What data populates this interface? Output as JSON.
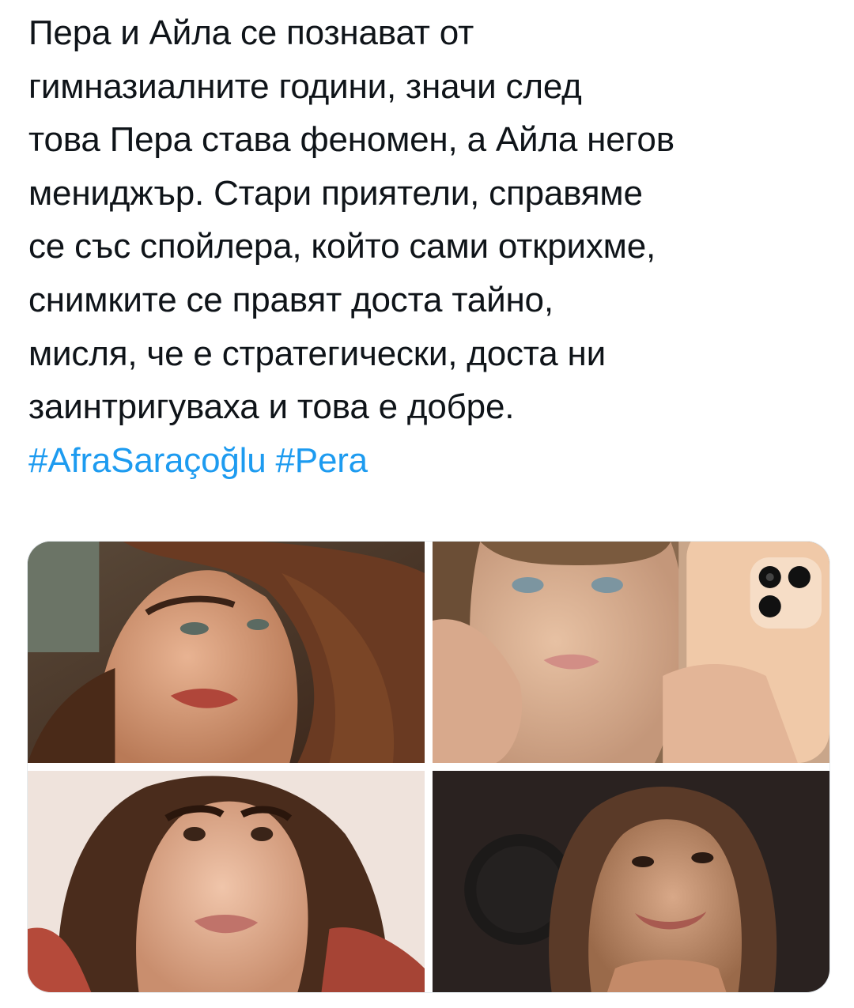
{
  "tweet": {
    "text_lines": [
      "Пера и Айла се познават от",
      "гимназиалните години, значи след",
      "това Пера става феномен, а Айла негов",
      "мениджър. Стари приятели, справяме",
      "се със спойлера, който сами открихме,",
      "снимките се правят доста тайно,",
      "мисля, че е стратегически, доста ни",
      "заинтригуваха и това е добре."
    ],
    "hashtags": [
      "#AfraSaraçoğlu",
      "#Pera"
    ]
  },
  "media": {
    "photos": [
      {
        "description": "portrait-photo-top-left"
      },
      {
        "description": "selfie-photo-top-right"
      },
      {
        "description": "portrait-photo-bottom-left"
      },
      {
        "description": "selfie-photo-bottom-right"
      }
    ]
  },
  "colors": {
    "text": "#0f1419",
    "hashtag": "#1d9bf0",
    "background": "#ffffff"
  }
}
